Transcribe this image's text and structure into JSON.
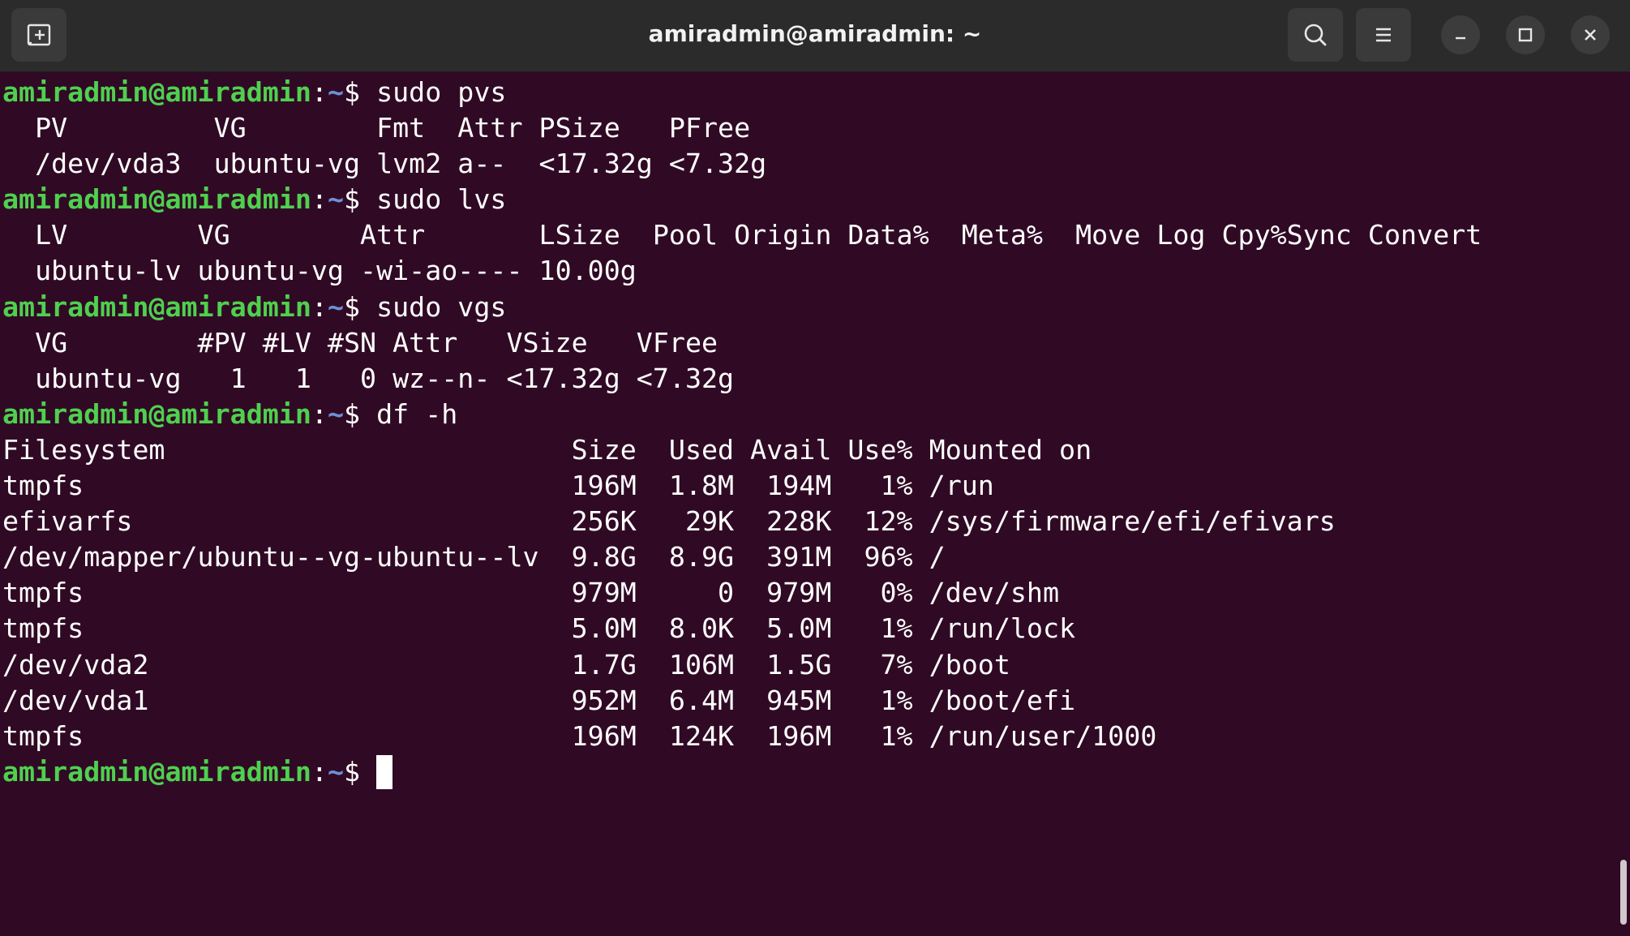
{
  "window": {
    "title": "amiradmin@amiradmin: ~"
  },
  "titlebar": {
    "new_tab_icon": "new-tab-icon",
    "search_icon": "search-icon",
    "menu_icon": "hamburger-menu-icon",
    "minimize_icon": "minimize-icon",
    "maximize_icon": "maximize-icon",
    "close_icon": "close-icon"
  },
  "colors": {
    "background": "#300a24",
    "prompt_user": "#4fd04f",
    "prompt_path": "#6f8fd8",
    "text": "#ffffff",
    "titlebar": "#2b2b2b"
  },
  "prompt": {
    "user_host": "amiradmin@amiradmin",
    "colon": ":",
    "path": "~",
    "symbol": "$ "
  },
  "terminal": {
    "lines": [
      {
        "type": "prompt",
        "command": "sudo pvs"
      },
      {
        "type": "output",
        "text": "  PV         VG        Fmt  Attr PSize   PFree"
      },
      {
        "type": "output",
        "text": "  /dev/vda3  ubuntu-vg lvm2 a--  <17.32g <7.32g"
      },
      {
        "type": "prompt",
        "command": "sudo lvs"
      },
      {
        "type": "output",
        "text": "  LV        VG        Attr       LSize  Pool Origin Data%  Meta%  Move Log Cpy%Sync Convert"
      },
      {
        "type": "output",
        "text": "  ubuntu-lv ubuntu-vg -wi-ao---- 10.00g"
      },
      {
        "type": "prompt",
        "command": "sudo vgs"
      },
      {
        "type": "output",
        "text": "  VG        #PV #LV #SN Attr   VSize   VFree"
      },
      {
        "type": "output",
        "text": "  ubuntu-vg   1   1   0 wz--n- <17.32g <7.32g"
      },
      {
        "type": "prompt",
        "command": "df -h"
      },
      {
        "type": "output",
        "text": "Filesystem                         Size  Used Avail Use% Mounted on"
      },
      {
        "type": "output",
        "text": "tmpfs                              196M  1.8M  194M   1% /run"
      },
      {
        "type": "output",
        "text": "efivarfs                           256K   29K  228K  12% /sys/firmware/efi/efivars"
      },
      {
        "type": "output",
        "text": "/dev/mapper/ubuntu--vg-ubuntu--lv  9.8G  8.9G  391M  96% /"
      },
      {
        "type": "output",
        "text": "tmpfs                              979M     0  979M   0% /dev/shm"
      },
      {
        "type": "output",
        "text": "tmpfs                              5.0M  8.0K  5.0M   1% /run/lock"
      },
      {
        "type": "output",
        "text": "/dev/vda2                          1.7G  106M  1.5G   7% /boot"
      },
      {
        "type": "output",
        "text": "/dev/vda1                          952M  6.4M  945M   1% /boot/efi"
      },
      {
        "type": "output",
        "text": "tmpfs                              196M  124K  196M   1% /run/user/1000"
      },
      {
        "type": "prompt",
        "command": "",
        "cursor": true
      }
    ]
  }
}
